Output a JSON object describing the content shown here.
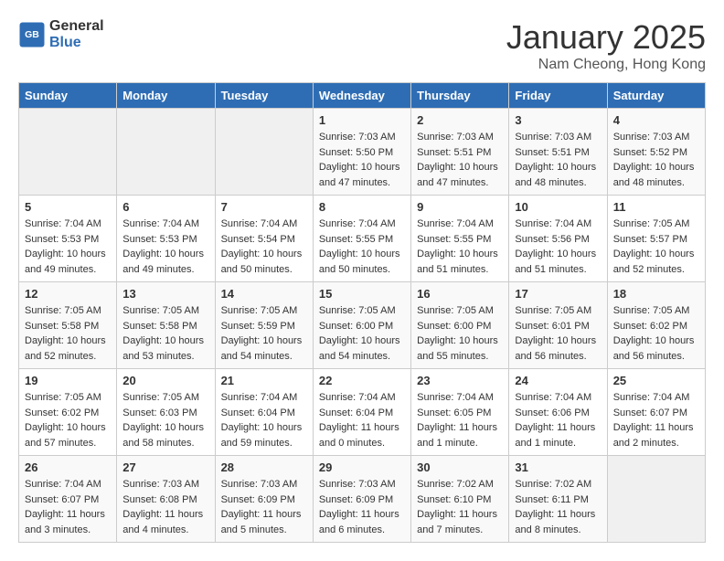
{
  "header": {
    "logo_general": "General",
    "logo_blue": "Blue",
    "title": "January 2025",
    "location": "Nam Cheong, Hong Kong"
  },
  "days_of_week": [
    "Sunday",
    "Monday",
    "Tuesday",
    "Wednesday",
    "Thursday",
    "Friday",
    "Saturday"
  ],
  "weeks": [
    [
      {
        "day": "",
        "empty": true
      },
      {
        "day": "",
        "empty": true
      },
      {
        "day": "",
        "empty": true
      },
      {
        "day": "1",
        "sunrise": "7:03 AM",
        "sunset": "5:50 PM",
        "daylight": "10 hours and 47 minutes."
      },
      {
        "day": "2",
        "sunrise": "7:03 AM",
        "sunset": "5:51 PM",
        "daylight": "10 hours and 47 minutes."
      },
      {
        "day": "3",
        "sunrise": "7:03 AM",
        "sunset": "5:51 PM",
        "daylight": "10 hours and 48 minutes."
      },
      {
        "day": "4",
        "sunrise": "7:03 AM",
        "sunset": "5:52 PM",
        "daylight": "10 hours and 48 minutes."
      }
    ],
    [
      {
        "day": "5",
        "sunrise": "7:04 AM",
        "sunset": "5:53 PM",
        "daylight": "10 hours and 49 minutes."
      },
      {
        "day": "6",
        "sunrise": "7:04 AM",
        "sunset": "5:53 PM",
        "daylight": "10 hours and 49 minutes."
      },
      {
        "day": "7",
        "sunrise": "7:04 AM",
        "sunset": "5:54 PM",
        "daylight": "10 hours and 50 minutes."
      },
      {
        "day": "8",
        "sunrise": "7:04 AM",
        "sunset": "5:55 PM",
        "daylight": "10 hours and 50 minutes."
      },
      {
        "day": "9",
        "sunrise": "7:04 AM",
        "sunset": "5:55 PM",
        "daylight": "10 hours and 51 minutes."
      },
      {
        "day": "10",
        "sunrise": "7:04 AM",
        "sunset": "5:56 PM",
        "daylight": "10 hours and 51 minutes."
      },
      {
        "day": "11",
        "sunrise": "7:05 AM",
        "sunset": "5:57 PM",
        "daylight": "10 hours and 52 minutes."
      }
    ],
    [
      {
        "day": "12",
        "sunrise": "7:05 AM",
        "sunset": "5:58 PM",
        "daylight": "10 hours and 52 minutes."
      },
      {
        "day": "13",
        "sunrise": "7:05 AM",
        "sunset": "5:58 PM",
        "daylight": "10 hours and 53 minutes."
      },
      {
        "day": "14",
        "sunrise": "7:05 AM",
        "sunset": "5:59 PM",
        "daylight": "10 hours and 54 minutes."
      },
      {
        "day": "15",
        "sunrise": "7:05 AM",
        "sunset": "6:00 PM",
        "daylight": "10 hours and 54 minutes."
      },
      {
        "day": "16",
        "sunrise": "7:05 AM",
        "sunset": "6:00 PM",
        "daylight": "10 hours and 55 minutes."
      },
      {
        "day": "17",
        "sunrise": "7:05 AM",
        "sunset": "6:01 PM",
        "daylight": "10 hours and 56 minutes."
      },
      {
        "day": "18",
        "sunrise": "7:05 AM",
        "sunset": "6:02 PM",
        "daylight": "10 hours and 56 minutes."
      }
    ],
    [
      {
        "day": "19",
        "sunrise": "7:05 AM",
        "sunset": "6:02 PM",
        "daylight": "10 hours and 57 minutes."
      },
      {
        "day": "20",
        "sunrise": "7:05 AM",
        "sunset": "6:03 PM",
        "daylight": "10 hours and 58 minutes."
      },
      {
        "day": "21",
        "sunrise": "7:04 AM",
        "sunset": "6:04 PM",
        "daylight": "10 hours and 59 minutes."
      },
      {
        "day": "22",
        "sunrise": "7:04 AM",
        "sunset": "6:04 PM",
        "daylight": "11 hours and 0 minutes."
      },
      {
        "day": "23",
        "sunrise": "7:04 AM",
        "sunset": "6:05 PM",
        "daylight": "11 hours and 1 minute."
      },
      {
        "day": "24",
        "sunrise": "7:04 AM",
        "sunset": "6:06 PM",
        "daylight": "11 hours and 1 minute."
      },
      {
        "day": "25",
        "sunrise": "7:04 AM",
        "sunset": "6:07 PM",
        "daylight": "11 hours and 2 minutes."
      }
    ],
    [
      {
        "day": "26",
        "sunrise": "7:04 AM",
        "sunset": "6:07 PM",
        "daylight": "11 hours and 3 minutes."
      },
      {
        "day": "27",
        "sunrise": "7:03 AM",
        "sunset": "6:08 PM",
        "daylight": "11 hours and 4 minutes."
      },
      {
        "day": "28",
        "sunrise": "7:03 AM",
        "sunset": "6:09 PM",
        "daylight": "11 hours and 5 minutes."
      },
      {
        "day": "29",
        "sunrise": "7:03 AM",
        "sunset": "6:09 PM",
        "daylight": "11 hours and 6 minutes."
      },
      {
        "day": "30",
        "sunrise": "7:02 AM",
        "sunset": "6:10 PM",
        "daylight": "11 hours and 7 minutes."
      },
      {
        "day": "31",
        "sunrise": "7:02 AM",
        "sunset": "6:11 PM",
        "daylight": "11 hours and 8 minutes."
      },
      {
        "day": "",
        "empty": true
      }
    ]
  ]
}
